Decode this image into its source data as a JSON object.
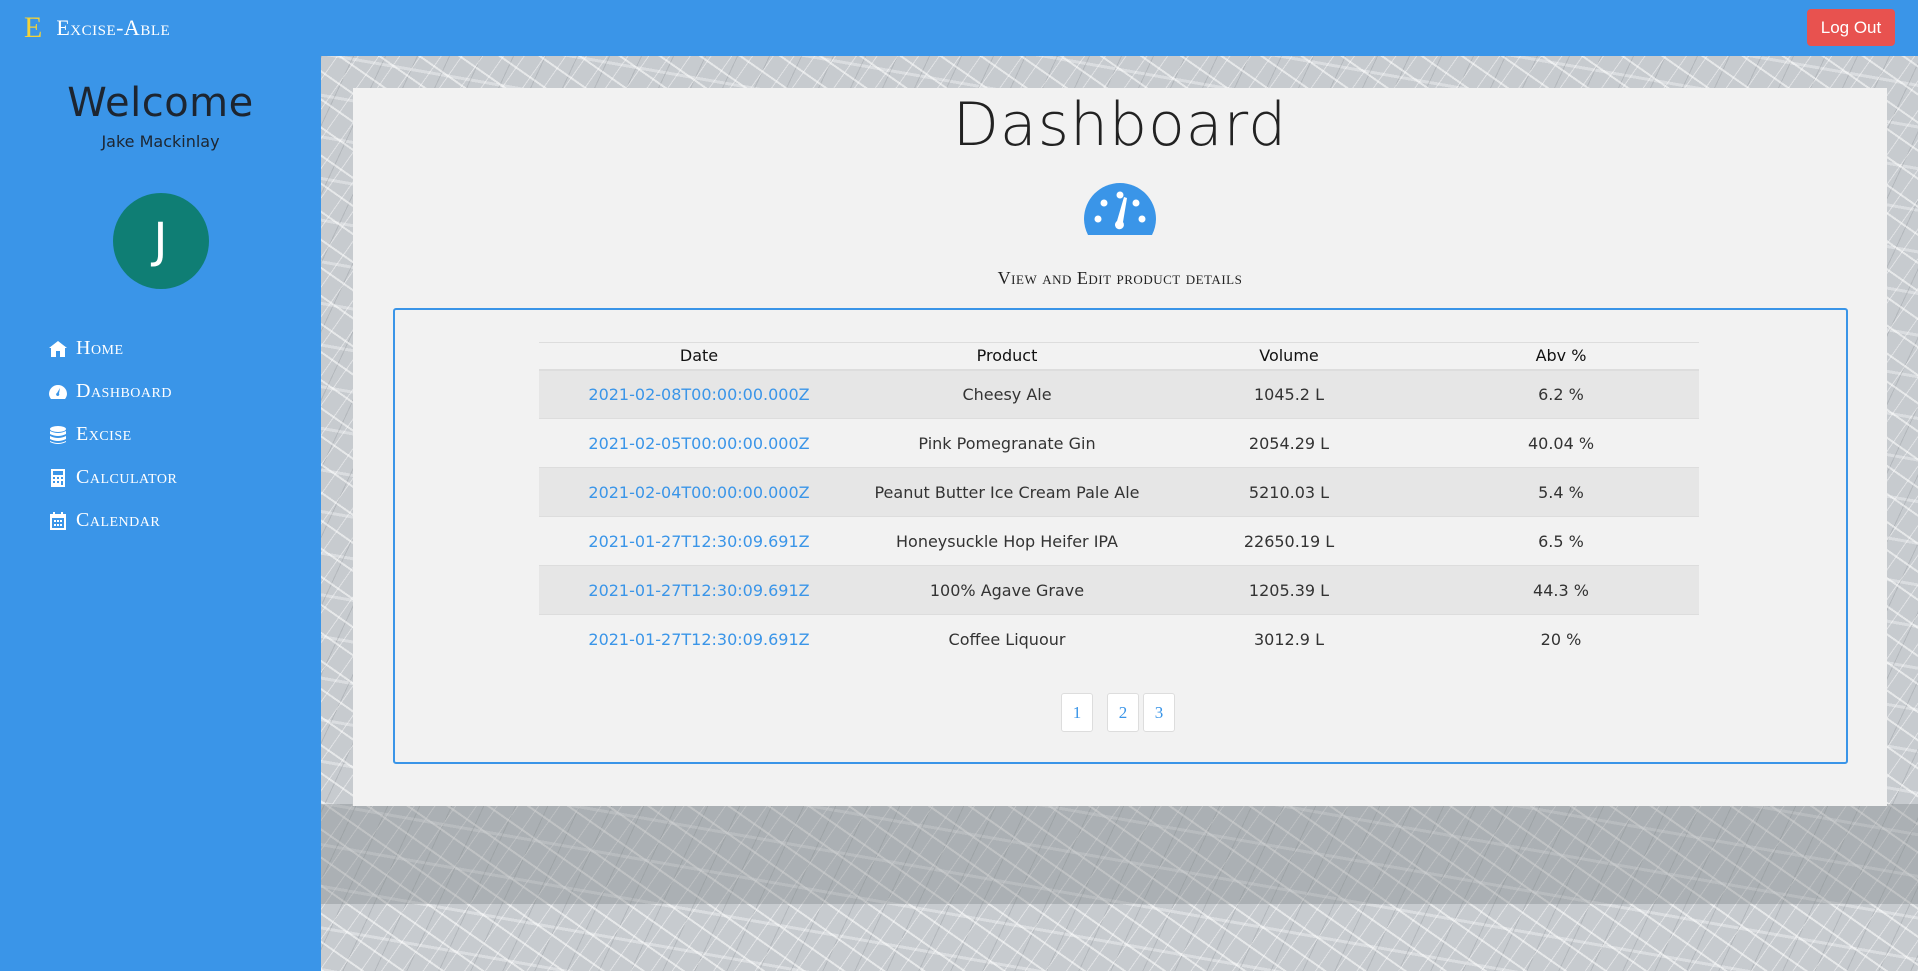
{
  "brand": {
    "logo_letter": "E",
    "name": "Excise-Able"
  },
  "header": {
    "logout_label": "Log Out"
  },
  "sidebar": {
    "welcome": "Welcome",
    "username": "Jake Mackinlay",
    "avatar_initial": "J",
    "items": [
      {
        "label": "Home",
        "icon": "home-icon"
      },
      {
        "label": "Dashboard",
        "icon": "dashboard-icon"
      },
      {
        "label": "Excise",
        "icon": "database-icon"
      },
      {
        "label": "Calculator",
        "icon": "calculator-icon"
      },
      {
        "label": "Calendar",
        "icon": "calendar-icon"
      }
    ]
  },
  "main": {
    "title": "Dashboard",
    "icon": "tachometer-icon",
    "subtitle": "View and Edit product details",
    "table": {
      "columns": [
        "Date",
        "Product",
        "Volume",
        "Abv %"
      ],
      "rows": [
        {
          "date": "2021-02-08T00:00:00.000Z",
          "product": "Cheesy Ale",
          "volume": "1045.2 L",
          "abv": "6.2 %"
        },
        {
          "date": "2021-02-05T00:00:00.000Z",
          "product": "Pink Pomegranate Gin",
          "volume": "2054.29 L",
          "abv": "40.04 %"
        },
        {
          "date": "2021-02-04T00:00:00.000Z",
          "product": "Peanut Butter Ice Cream Pale Ale",
          "volume": "5210.03 L",
          "abv": "5.4 %"
        },
        {
          "date": "2021-01-27T12:30:09.691Z",
          "product": "Honeysuckle Hop Heifer IPA",
          "volume": "22650.19 L",
          "abv": "6.5 %"
        },
        {
          "date": "2021-01-27T12:30:09.691Z",
          "product": "100% Agave Grave",
          "volume": "1205.39 L",
          "abv": "44.3 %"
        },
        {
          "date": "2021-01-27T12:30:09.691Z",
          "product": "Coffee Liquour",
          "volume": "3012.9 L",
          "abv": "20 %"
        }
      ]
    },
    "pagination": [
      "1",
      "2",
      "3"
    ]
  },
  "colors": {
    "primary": "#3a95e8",
    "logout": "#e8524f",
    "avatar": "#0f7e74",
    "logo": "#f2d23a"
  }
}
